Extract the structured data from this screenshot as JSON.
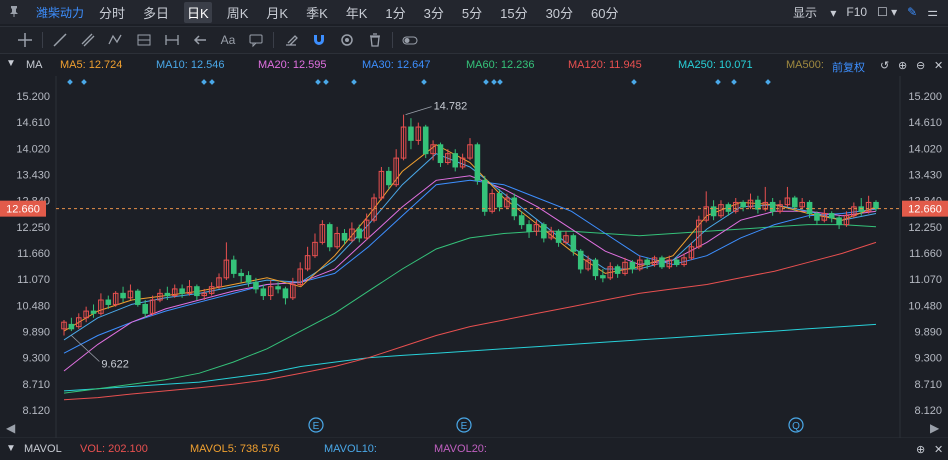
{
  "header": {
    "stock_name": "潍柴动力",
    "periods": [
      "分时",
      "多日",
      "日K",
      "周K",
      "月K",
      "季K",
      "年K",
      "1分",
      "3分",
      "5分",
      "15分",
      "30分",
      "60分"
    ],
    "active_period": "日K",
    "display_label": "显示",
    "f10_label": "F10"
  },
  "toolbar": {
    "text_tool": "Aa"
  },
  "ma_bar": {
    "label": "MA",
    "items": [
      {
        "text": "MA5: 12.724",
        "color": "#f0a030"
      },
      {
        "text": "MA10: 12.546",
        "color": "#4aa8e8"
      },
      {
        "text": "MA20: 12.595",
        "color": "#e070e0"
      },
      {
        "text": "MA30: 12.647",
        "color": "#3d8fff"
      },
      {
        "text": "MA60: 12.236",
        "color": "#35c27a"
      },
      {
        "text": "MA120: 11.945",
        "color": "#e85050"
      },
      {
        "text": "MA250: 10.071",
        "color": "#28d0d8"
      },
      {
        "text": "MA500:",
        "color": "#a08a40"
      }
    ],
    "adjust_label": "前复权"
  },
  "chart_data": {
    "type": "candlestick",
    "y_ticks": [
      "15.200",
      "14.610",
      "14.020",
      "13.430",
      "12.840",
      "12.250",
      "11.660",
      "11.070",
      "10.480",
      "9.890",
      "9.300",
      "8.710",
      "8.120"
    ],
    "ylim": [
      8.12,
      15.2
    ],
    "current_price": "12.660",
    "high_label": "14.782",
    "low_label": "9.622",
    "series_colors": {
      "up": "#e85050",
      "down": "#35c27a"
    },
    "candles": [
      [
        9.95,
        10.1,
        9.8,
        10.15
      ],
      [
        10.05,
        9.95,
        9.9,
        10.2
      ],
      [
        10.0,
        10.2,
        9.95,
        10.3
      ],
      [
        10.2,
        10.35,
        10.1,
        10.45
      ],
      [
        10.35,
        10.3,
        10.2,
        10.5
      ],
      [
        10.3,
        10.6,
        10.25,
        10.75
      ],
      [
        10.6,
        10.5,
        10.4,
        10.7
      ],
      [
        10.5,
        10.75,
        10.45,
        10.8
      ],
      [
        10.75,
        10.65,
        10.55,
        10.9
      ],
      [
        10.65,
        10.8,
        10.6,
        10.95
      ],
      [
        10.8,
        10.5,
        10.45,
        10.85
      ],
      [
        10.5,
        10.3,
        10.2,
        10.6
      ],
      [
        10.3,
        10.6,
        10.25,
        10.7
      ],
      [
        10.6,
        10.75,
        10.55,
        10.85
      ],
      [
        10.75,
        10.7,
        10.6,
        10.9
      ],
      [
        10.7,
        10.85,
        10.65,
        10.95
      ],
      [
        10.85,
        10.75,
        10.65,
        10.95
      ],
      [
        10.75,
        10.9,
        10.7,
        11.05
      ],
      [
        10.9,
        10.7,
        10.6,
        10.95
      ],
      [
        10.7,
        10.75,
        10.6,
        10.85
      ],
      [
        10.75,
        10.9,
        10.7,
        11.0
      ],
      [
        10.9,
        11.1,
        10.85,
        11.2
      ],
      [
        11.1,
        11.5,
        11.05,
        11.9
      ],
      [
        11.5,
        11.2,
        11.1,
        11.6
      ],
      [
        11.2,
        11.15,
        11.0,
        11.3
      ],
      [
        11.15,
        11.0,
        10.9,
        11.25
      ],
      [
        11.0,
        10.85,
        10.75,
        11.1
      ],
      [
        10.85,
        10.7,
        10.6,
        10.95
      ],
      [
        10.7,
        10.9,
        10.6,
        11.05
      ],
      [
        10.9,
        10.85,
        10.75,
        11.0
      ],
      [
        10.85,
        10.65,
        10.5,
        10.9
      ],
      [
        10.65,
        10.95,
        10.6,
        11.1
      ],
      [
        10.95,
        11.3,
        10.9,
        11.45
      ],
      [
        11.3,
        11.6,
        11.25,
        11.8
      ],
      [
        11.6,
        11.9,
        11.55,
        12.1
      ],
      [
        11.9,
        12.3,
        11.85,
        12.4
      ],
      [
        12.3,
        11.8,
        11.7,
        12.35
      ],
      [
        11.8,
        12.1,
        11.75,
        12.25
      ],
      [
        12.1,
        11.95,
        11.85,
        12.2
      ],
      [
        11.95,
        12.2,
        11.9,
        12.35
      ],
      [
        12.2,
        12.0,
        11.9,
        12.3
      ],
      [
        12.0,
        12.4,
        11.95,
        12.55
      ],
      [
        12.4,
        12.9,
        12.35,
        13.0
      ],
      [
        12.9,
        13.5,
        12.85,
        13.6
      ],
      [
        13.5,
        13.2,
        13.1,
        13.6
      ],
      [
        13.2,
        13.8,
        13.15,
        14.0
      ],
      [
        13.8,
        14.5,
        13.75,
        14.78
      ],
      [
        14.5,
        14.2,
        14.0,
        14.7
      ],
      [
        14.2,
        14.5,
        14.1,
        14.6
      ],
      [
        14.5,
        13.9,
        13.8,
        14.55
      ],
      [
        13.9,
        14.1,
        13.75,
        14.2
      ],
      [
        14.1,
        13.7,
        13.6,
        14.15
      ],
      [
        13.7,
        13.9,
        13.65,
        14.0
      ],
      [
        13.9,
        13.6,
        13.5,
        14.0
      ],
      [
        13.6,
        13.8,
        13.55,
        13.9
      ],
      [
        13.8,
        14.1,
        13.75,
        14.25
      ],
      [
        14.1,
        13.3,
        13.2,
        14.15
      ],
      [
        13.3,
        12.6,
        12.5,
        13.4
      ],
      [
        12.6,
        13.0,
        12.55,
        13.1
      ],
      [
        13.0,
        12.7,
        12.6,
        13.1
      ],
      [
        12.7,
        12.9,
        12.65,
        13.0
      ],
      [
        12.9,
        12.5,
        12.4,
        13.0
      ],
      [
        12.5,
        12.3,
        12.2,
        12.6
      ],
      [
        12.3,
        12.15,
        12.0,
        12.4
      ],
      [
        12.15,
        12.3,
        12.05,
        12.4
      ],
      [
        12.3,
        12.0,
        11.9,
        12.35
      ],
      [
        12.0,
        12.15,
        11.95,
        12.25
      ],
      [
        12.15,
        11.9,
        11.8,
        12.2
      ],
      [
        11.9,
        12.05,
        11.85,
        12.15
      ],
      [
        12.05,
        11.7,
        11.6,
        12.1
      ],
      [
        11.7,
        11.3,
        11.2,
        11.75
      ],
      [
        11.3,
        11.5,
        11.25,
        11.6
      ],
      [
        11.5,
        11.15,
        11.05,
        11.55
      ],
      [
        11.15,
        11.1,
        11.0,
        11.3
      ],
      [
        11.1,
        11.35,
        11.05,
        11.45
      ],
      [
        11.35,
        11.2,
        11.1,
        11.4
      ],
      [
        11.2,
        11.45,
        11.15,
        11.55
      ],
      [
        11.45,
        11.3,
        11.2,
        11.5
      ],
      [
        11.3,
        11.5,
        11.25,
        11.6
      ],
      [
        11.5,
        11.4,
        11.3,
        11.55
      ],
      [
        11.4,
        11.55,
        11.35,
        11.6
      ],
      [
        11.55,
        11.35,
        11.3,
        11.6
      ],
      [
        11.35,
        11.5,
        11.3,
        11.6
      ],
      [
        11.5,
        11.4,
        11.35,
        11.55
      ],
      [
        11.4,
        11.55,
        11.35,
        11.65
      ],
      [
        11.55,
        11.8,
        11.5,
        11.9
      ],
      [
        11.8,
        12.4,
        11.75,
        12.5
      ],
      [
        12.4,
        12.7,
        12.35,
        13.05
      ],
      [
        12.7,
        12.5,
        12.4,
        12.85
      ],
      [
        12.5,
        12.75,
        12.45,
        12.85
      ],
      [
        12.75,
        12.6,
        12.5,
        12.8
      ],
      [
        12.6,
        12.8,
        12.55,
        12.9
      ],
      [
        12.8,
        12.7,
        12.6,
        12.85
      ],
      [
        12.7,
        12.85,
        12.65,
        13.0
      ],
      [
        12.85,
        12.65,
        12.55,
        12.95
      ],
      [
        12.65,
        12.8,
        12.6,
        13.15
      ],
      [
        12.8,
        12.6,
        12.5,
        12.9
      ],
      [
        12.6,
        12.75,
        12.55,
        12.85
      ],
      [
        12.75,
        12.9,
        12.7,
        13.15
      ],
      [
        12.9,
        12.7,
        12.6,
        12.95
      ],
      [
        12.7,
        12.8,
        12.65,
        12.9
      ],
      [
        12.8,
        12.55,
        12.45,
        12.85
      ],
      [
        12.55,
        12.4,
        12.3,
        12.6
      ],
      [
        12.4,
        12.55,
        12.35,
        12.65
      ],
      [
        12.55,
        12.45,
        12.35,
        12.6
      ],
      [
        12.45,
        12.3,
        12.2,
        12.5
      ],
      [
        12.3,
        12.5,
        12.25,
        12.6
      ],
      [
        12.5,
        12.7,
        12.45,
        12.8
      ],
      [
        12.7,
        12.6,
        12.5,
        12.9
      ],
      [
        12.6,
        12.8,
        12.55,
        12.95
      ],
      [
        12.8,
        12.66,
        12.6,
        12.85
      ]
    ],
    "ma_lines": [
      {
        "name": "MA250",
        "color": "#28d0d8",
        "values": [
          8.55,
          8.6,
          8.65,
          8.7,
          8.75,
          8.85,
          8.95,
          9.1,
          9.2,
          9.3,
          9.35,
          9.4,
          9.45,
          9.5,
          9.55,
          9.6,
          9.65,
          9.7,
          9.75,
          9.8,
          9.85,
          9.9,
          9.95,
          10.0,
          10.05
        ]
      },
      {
        "name": "MA120",
        "color": "#e85050",
        "values": [
          8.35,
          8.4,
          8.48,
          8.55,
          8.62,
          8.7,
          8.8,
          8.95,
          9.1,
          9.3,
          9.55,
          9.8,
          10.0,
          10.15,
          10.3,
          10.45,
          10.6,
          10.75,
          10.85,
          10.95,
          11.1,
          11.25,
          11.45,
          11.65,
          11.9
        ]
      },
      {
        "name": "MA60",
        "color": "#35c27a",
        "values": [
          8.5,
          8.6,
          8.7,
          8.8,
          8.95,
          9.2,
          9.5,
          9.9,
          10.3,
          10.8,
          11.3,
          11.75,
          12.0,
          12.1,
          12.15,
          12.15,
          12.1,
          12.05,
          12.1,
          12.15,
          12.2,
          12.25,
          12.3,
          12.3,
          12.25
        ]
      },
      {
        "name": "MA30",
        "color": "#3d8fff",
        "values": [
          9.4,
          9.8,
          10.1,
          10.35,
          10.55,
          10.75,
          10.95,
          11.0,
          11.2,
          11.8,
          12.5,
          13.2,
          13.3,
          13.2,
          12.9,
          12.6,
          12.1,
          11.6,
          11.4,
          11.6,
          12.0,
          12.3,
          12.5,
          12.55,
          12.65
        ]
      },
      {
        "name": "MA20",
        "color": "#e070e0",
        "values": [
          9.0,
          9.6,
          10.1,
          10.4,
          10.6,
          10.8,
          10.95,
          11.0,
          11.3,
          12.0,
          12.7,
          13.3,
          13.4,
          13.1,
          12.7,
          12.2,
          11.7,
          11.4,
          11.5,
          11.9,
          12.4,
          12.6,
          12.6,
          12.5,
          12.6
        ]
      },
      {
        "name": "MA10",
        "color": "#4aa8e8",
        "values": [
          9.7,
          10.2,
          10.5,
          10.65,
          10.75,
          10.9,
          11.05,
          11.0,
          11.5,
          12.3,
          13.2,
          13.9,
          13.6,
          13.0,
          12.4,
          11.8,
          11.3,
          11.3,
          11.5,
          12.2,
          12.7,
          12.75,
          12.6,
          12.4,
          12.55
        ]
      },
      {
        "name": "MA5",
        "color": "#f0a030",
        "values": [
          9.9,
          10.35,
          10.6,
          10.7,
          10.8,
          10.95,
          11.1,
          10.9,
          11.6,
          12.5,
          13.5,
          14.1,
          13.7,
          12.9,
          12.3,
          11.7,
          11.2,
          11.35,
          11.6,
          12.5,
          12.8,
          12.75,
          12.55,
          12.4,
          12.7
        ]
      }
    ],
    "event_markers": [
      "E",
      "E",
      "Q"
    ]
  },
  "volume_bar": {
    "label": "MAVOL",
    "items": [
      {
        "text": "VOL: 202.100",
        "color": "#e85050"
      },
      {
        "text": "MAVOL5: 738.576",
        "color": "#f0a030"
      },
      {
        "text": "MAVOL10:",
        "color": "#4aa8e8"
      },
      {
        "text": "MAVOL20:",
        "color": "#c060c0"
      }
    ]
  }
}
